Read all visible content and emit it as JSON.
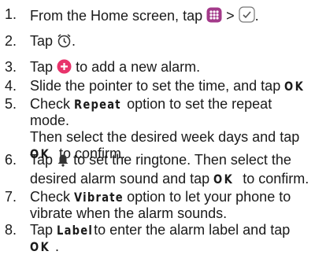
{
  "steps": [
    {
      "num": "1.",
      "a": "From the Home screen, tap",
      "sep": ">",
      "end": ".",
      "icons": [
        "apps-icon",
        "clock-app-icon"
      ],
      "accent": "#a33a8a"
    },
    {
      "num": "2.",
      "a": "Tap",
      "end": ".",
      "icons": [
        "alarm-clock-icon"
      ]
    },
    {
      "num": "3.",
      "a": "Tap",
      "b": "to add a new alarm.",
      "icons": [
        "add-alarm-icon"
      ],
      "accent": "#e8336b"
    },
    {
      "num": "4.",
      "a": "Slide the pointer to set the time, and tap",
      "kw": "OK",
      "end": "."
    },
    {
      "num": "5.",
      "a": "Check",
      "kw": "Repeat",
      "b": "option to set the repeat mode.",
      "c": "Then select the desired week days and tap",
      "kw2": "OK",
      "d": "to confirm."
    },
    {
      "num": "6.",
      "a": "Tap",
      "b": "to set the ringtone. Then select the",
      "c": "desired alarm sound and tap",
      "kw": "OK",
      "d": "to confirm.",
      "icons": [
        "bell-icon"
      ]
    },
    {
      "num": "7.",
      "a": "Check",
      "kw": "Vibrate",
      "b": "option to let your phone to",
      "c": "vibrate when the alarm sounds."
    },
    {
      "num": "8.",
      "a": "Tap",
      "kw": "Label",
      "b": "to enter the alarm label and tap",
      "kw2": "OK",
      "end": "."
    }
  ]
}
